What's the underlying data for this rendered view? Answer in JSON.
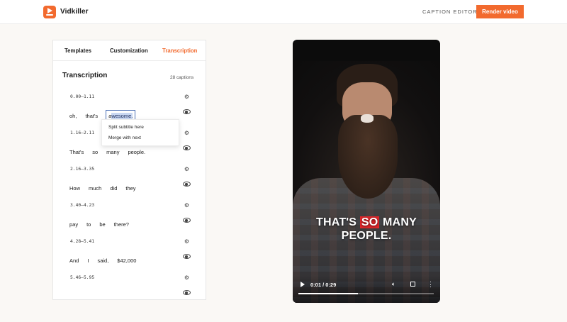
{
  "app": {
    "brand": "Vidkiller",
    "nav_link": "CAPTION EDITOR",
    "render_button": "Render video",
    "accent_color": "#f26a2e"
  },
  "panel": {
    "tabs": [
      {
        "label": "Templates"
      },
      {
        "label": "Customization"
      },
      {
        "label": "Transcription",
        "active": true
      }
    ],
    "title": "Transcription",
    "count": "28 captions"
  },
  "captions": [
    {
      "time": "0.00—1.11",
      "words": [
        "oh,",
        "that's",
        "awesome."
      ]
    },
    {
      "time": "1.16—2.11",
      "words": [
        "That's",
        "so",
        "many",
        "people."
      ]
    },
    {
      "time": "2.16—3.35",
      "words": [
        "How",
        "much",
        "did",
        "they"
      ]
    },
    {
      "time": "3.40—4.23",
      "words": [
        "pay",
        "to",
        "be",
        "there?"
      ]
    },
    {
      "time": "4.28—5.41",
      "words": [
        "And",
        "I",
        "said,",
        "$42,000"
      ]
    },
    {
      "time": "5.46—5.95",
      "words": []
    }
  ],
  "selected_word": {
    "prefix": "a",
    "highlight": "wesome."
  },
  "context_menu": {
    "items": [
      "Split subtitle here",
      "Merge with next"
    ]
  },
  "video": {
    "caption_line1_pre": "THAT'S",
    "caption_line1_hl": "SO",
    "caption_line1_post": "MANY",
    "caption_line2": "PEOPLE.",
    "caption_highlight_color": "#e0262a",
    "time_display": "0:01 / 0:29",
    "progress_fraction": 0.44
  }
}
